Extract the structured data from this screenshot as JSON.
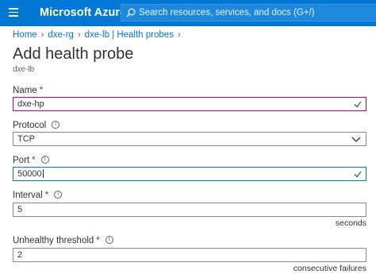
{
  "header": {
    "menu_icon": "hamburger-menu-icon",
    "brand": "Microsoft Azure",
    "search_placeholder": "Search resources, services, and docs (G+/)",
    "search_icon": "search-icon"
  },
  "breadcrumb": {
    "items": [
      "Home",
      "dxe-rg",
      "dxe-lb | Health probes"
    ],
    "separator_icon": "chevron-right-icon"
  },
  "page": {
    "title": "Add health probe",
    "subtitle": "dxe-lb"
  },
  "form": {
    "name": {
      "label": "Name",
      "required": "*",
      "value": "dxe-hp",
      "status_icon": "checkmark-icon"
    },
    "protocol": {
      "label": "Protocol",
      "value": "TCP",
      "info_icon": "info-icon",
      "dropdown_icon": "chevron-down-icon"
    },
    "port": {
      "label": "Port",
      "required": "*",
      "value": "50000",
      "info_icon": "info-icon",
      "status_icon": "checkmark-icon"
    },
    "interval": {
      "label": "Interval",
      "required": "*",
      "value": "5",
      "unit": "seconds",
      "info_icon": "info-icon"
    },
    "unhealthy_threshold": {
      "label": "Unhealthy threshold",
      "required": "*",
      "value": "2",
      "unit": "consecutive failures",
      "info_icon": "info-icon"
    }
  },
  "colors": {
    "brand_blue": "#0078d4",
    "valid_green": "#107c10",
    "required_red": "#a4262c",
    "dirty_border": "#b4008a"
  }
}
